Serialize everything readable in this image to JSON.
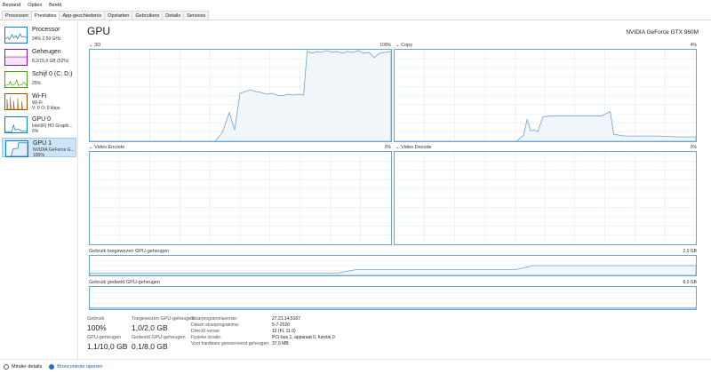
{
  "menu": [
    "Bestand",
    "Opties",
    "Beeld"
  ],
  "tabs": [
    "Processen",
    "Prestaties",
    "App-geschiedenis",
    "Opstarten",
    "Gebruikers",
    "Details",
    "Services"
  ],
  "active_tab": "Prestaties",
  "sidebar": [
    {
      "title": "Processor",
      "line1": "24%  2,59 GHz",
      "line2": "",
      "color": "#117dbb"
    },
    {
      "title": "Geheugen",
      "line1": "8,2/15,9 GB (52%)",
      "line2": "",
      "color": "#8b12ae"
    },
    {
      "title": "Schijf 0 (C: D:)",
      "line1": "25%",
      "line2": "",
      "color": "#4da60c"
    },
    {
      "title": "Wi-Fi",
      "line1": "Wi-Fi",
      "line2": "V: 0  O: 0 kbps",
      "color": "#a74f01"
    },
    {
      "title": "GPU 0",
      "line1": "Intel(R) HD Graphi...",
      "line2": "6%",
      "color": "#117dbb"
    },
    {
      "title": "GPU 1",
      "line1": "NVIDIA GeForce G...",
      "line2": "100%",
      "color": "#117dbb"
    }
  ],
  "header": {
    "title": "GPU",
    "model": "NVIDIA GeForce GTX 960M"
  },
  "engines": [
    {
      "name": "3D",
      "pct": "100%"
    },
    {
      "name": "Copy",
      "pct": "4%"
    },
    {
      "name": "Video Encode",
      "pct": "0%"
    },
    {
      "name": "Video Decode",
      "pct": "0%"
    }
  ],
  "dedicated": {
    "label": "Gebruik toegewezen GPU-geheugen",
    "max": "2,0 GB"
  },
  "shared": {
    "label": "Gebruik gedeeld GPU-geheugen",
    "max": "8,0 GB"
  },
  "stats": [
    {
      "label": "Gebruik",
      "value": "100%"
    },
    {
      "label": "Toegewezen GPU-geheugen",
      "value": "1,0/2,0 GB"
    },
    {
      "label": "GPU-geheugen",
      "value": "1,1/10,0 GB"
    },
    {
      "label": "Gedeeld GPU-geheugen",
      "value": "0,1/8,0 GB"
    }
  ],
  "info": [
    {
      "k": "Stuurprogrammaversie:",
      "v": "27.21.14.5167"
    },
    {
      "k": "Datum stuurprogramma:",
      "v": "5-7-2020"
    },
    {
      "k": "DirectX-versie:",
      "v": "12 (FL 11.0)"
    },
    {
      "k": "Fysieke locatie:",
      "v": "PCI-bus 1, apparaat 0, functie 0"
    },
    {
      "k": "Voor hardware gereserveerd geheugen:",
      "v": "37,9 MB"
    }
  ],
  "footer": {
    "less": "Minder details",
    "monitor": "Broncontrole openen"
  },
  "colors": {
    "accent": "#117dbb",
    "graph_border": "#6ba2cf",
    "graph_fill": "#f1f6fb"
  }
}
